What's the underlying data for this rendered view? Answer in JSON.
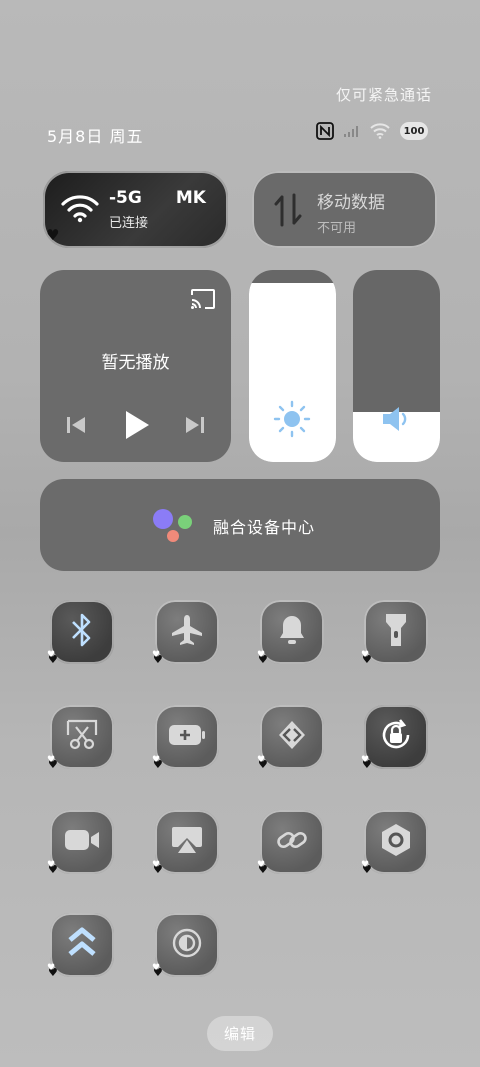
{
  "status_bar": {
    "emergency_text": "仅可紧急通话",
    "date_text": "5月8日 周五",
    "battery_text": "100"
  },
  "wifi_card": {
    "title": "-5G",
    "title_suffix": "MK",
    "subtitle": "已连接"
  },
  "data_card": {
    "title": "移动数据",
    "subtitle": "不可用"
  },
  "media": {
    "title": "暂无播放"
  },
  "brightness": {
    "level": 0.93
  },
  "volume": {
    "level": 0.26
  },
  "fusion": {
    "label": "融合设备中心"
  },
  "tiles": [
    {
      "icon": "bluetooth-icon",
      "active": true
    },
    {
      "icon": "airplane-icon",
      "active": false
    },
    {
      "icon": "bell-icon",
      "active": false
    },
    {
      "icon": "flashlight-icon",
      "active": false
    },
    {
      "icon": "screenshot-icon",
      "active": false
    },
    {
      "icon": "battery-saver-icon",
      "active": false
    },
    {
      "icon": "code-icon",
      "active": false
    },
    {
      "icon": "rotation-lock-icon",
      "active": true
    },
    {
      "icon": "video-icon",
      "active": false
    },
    {
      "icon": "cast-icon",
      "active": false
    },
    {
      "icon": "link-icon",
      "active": false
    },
    {
      "icon": "settings-hex-icon",
      "active": false
    },
    {
      "icon": "chevrons-up-icon",
      "active": false
    },
    {
      "icon": "contrast-icon",
      "active": false
    }
  ],
  "edit_button": {
    "label": "编辑"
  }
}
